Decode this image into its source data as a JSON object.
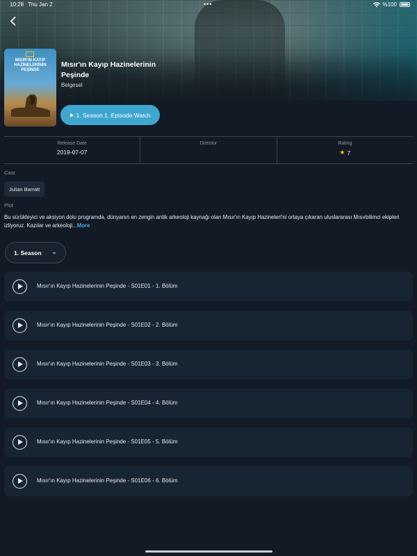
{
  "status_bar": {
    "time": "10:28",
    "date": "Thu Jan 2",
    "battery": "%100"
  },
  "poster": {
    "title": "MISIR'IN KAYIP HAZİNELERİNİN PEŞİNDE"
  },
  "show": {
    "title": "Mısır'ın Kayıp Hazinelerinin Peşinde",
    "genre": "Belgesel"
  },
  "watch_button": {
    "label": "1. Season 1. Episode Watch"
  },
  "info": {
    "release_label": "Release Date",
    "release_value": "2019-07-07",
    "director_label": "Director",
    "director_value": "",
    "rating_label": "Rating",
    "rating_value": "7"
  },
  "cast": {
    "label": "Cast",
    "members": [
      "Julian Barratt"
    ]
  },
  "plot": {
    "label": "Plot",
    "text": "Bu sürükleyici ve aksiyon dolu programda, dünyanın en zengin antik arkeoloji kaynağı olan Mısır'ın Kayıp Hazineleri'ni ortaya çıkaran uluslararası Mısırbilimci ekipleri izliyoruz. Kazılar ve arkeoloji...",
    "more": "More"
  },
  "season_select": {
    "value": "1. Season"
  },
  "episodes": [
    "Mısır'ın Kayıp Hazinelerinin Peşinde - S01E01 - 1. Bölüm",
    "Mısır'ın Kayıp Hazinelerinin Peşinde - S01E02 - 2. Bölüm",
    "Mısır'ın Kayıp Hazinelerinin Peşinde - S01E03 - 3. Bölüm",
    "Mısır'ın Kayıp Hazinelerinin Peşinde - S01E04 - 4. Bölüm",
    "Mısır'ın Kayıp Hazinelerinin Peşinde - S01E05 - 5. Bölüm",
    "Mısır'ın Kayıp Hazinelerinin Peşinde - S01E06 - 6. Bölüm"
  ],
  "colors": {
    "background": "#121a25",
    "accent": "#3fa7cf",
    "card": "#172431",
    "more_link": "#4aa8e0",
    "star": "#f5c518"
  }
}
